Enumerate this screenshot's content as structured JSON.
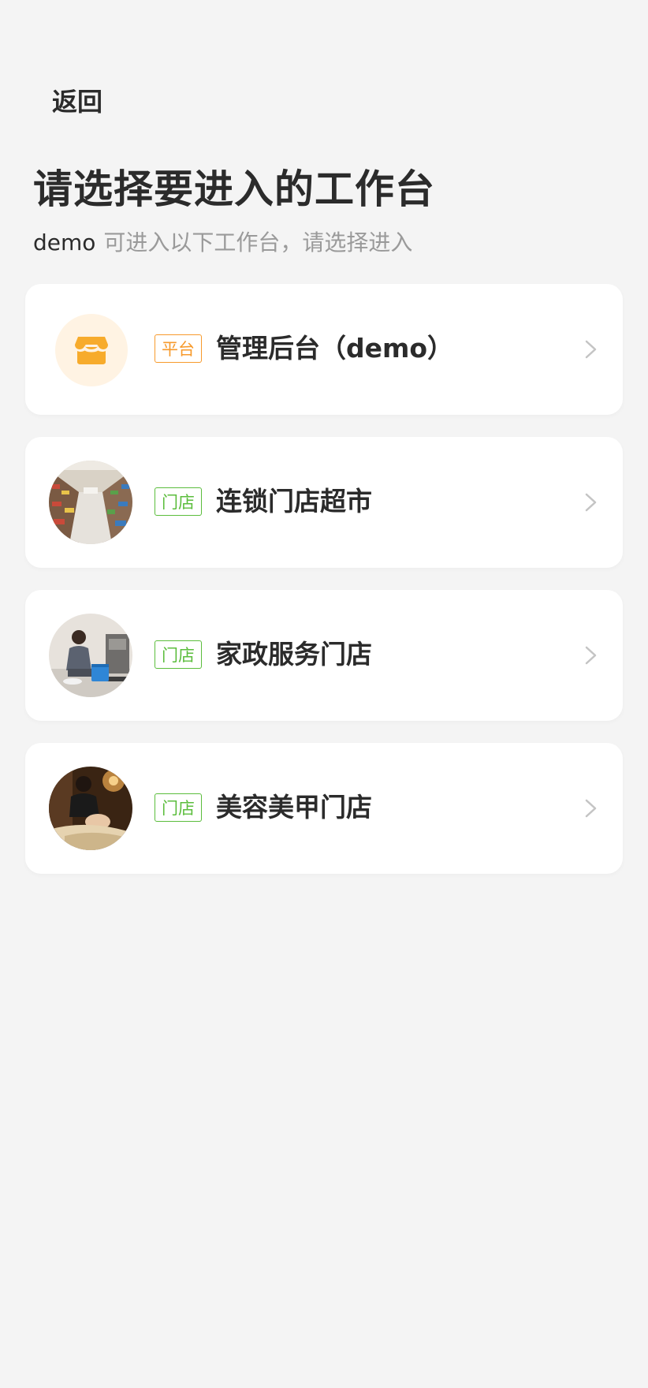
{
  "header": {
    "back_label": "返回",
    "title": "请选择要进入的工作台",
    "subtitle_user": "demo",
    "subtitle_text": "可进入以下工作台，请选择进入"
  },
  "workspaces": [
    {
      "tag": "平台",
      "tag_type": "platform",
      "name": "管理后台（demo）",
      "icon": "store-icon",
      "tag_color": "#f79a2c"
    },
    {
      "tag": "门店",
      "tag_type": "store",
      "name": "连锁门店超市",
      "icon": "supermarket-photo",
      "tag_color": "#5bbd3c"
    },
    {
      "tag": "门店",
      "tag_type": "store",
      "name": "家政服务门店",
      "icon": "housekeeping-photo",
      "tag_color": "#5bbd3c"
    },
    {
      "tag": "门店",
      "tag_type": "store",
      "name": "美容美甲门店",
      "icon": "beauty-salon-photo",
      "tag_color": "#5bbd3c"
    }
  ],
  "colors": {
    "background": "#f4f4f4",
    "card": "#ffffff",
    "platform_accent": "#f79a2c",
    "store_accent": "#5bbd3c",
    "chevron": "#c4c4c4"
  }
}
